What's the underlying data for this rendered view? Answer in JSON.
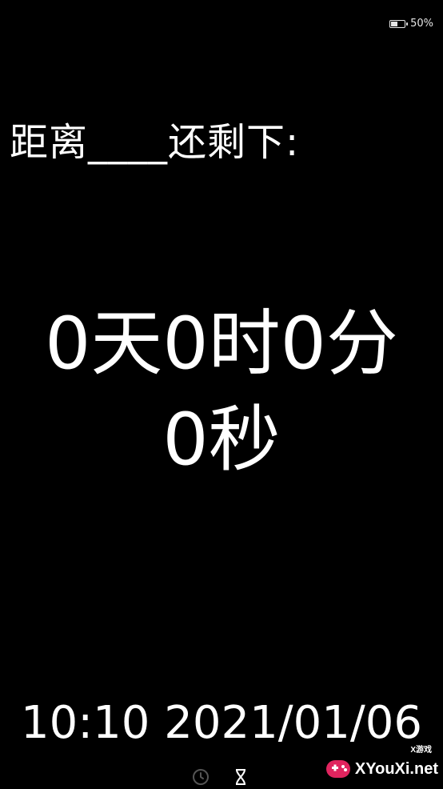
{
  "status_bar": {
    "battery_icon": "battery-icon",
    "battery_level": 0.5,
    "battery_text": "50%"
  },
  "heading": {
    "text": "距离____还剩下:"
  },
  "countdown": {
    "line1": "0天0时0分",
    "line2": "0秒"
  },
  "footer": {
    "datetime": "10:10 2021/01/06",
    "icons": [
      "clock-icon",
      "hourglass-icon"
    ]
  },
  "watermark": {
    "text": "XYouXi.net",
    "subtext": "X游戏"
  }
}
